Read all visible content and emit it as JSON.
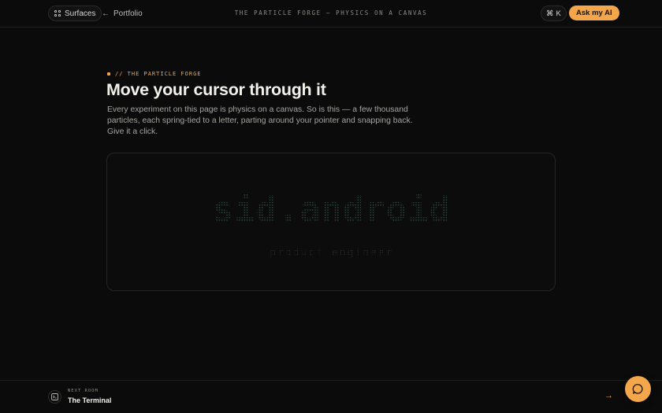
{
  "topbar": {
    "surfaces_label": "Surfaces",
    "portfolio_label": "Portfolio",
    "title": "THE PARTICLE FORGE — PHYSICS ON A CANVAS",
    "cmd_symbol": "⌘",
    "cmd_key": "K",
    "ask_label": "Ask my AI"
  },
  "hero": {
    "eyebrow": "// THE PARTICLE FORGE",
    "headline": "Move your cursor through it",
    "lede": "Every experiment on this page is physics on a canvas. So is this — a few thousand particles, each spring-tied to a letter, parting around your pointer and snapping back. Give it a click."
  },
  "canvas": {
    "primary_text": "sid.android",
    "secondary_text": "product engineer",
    "particle_color": "#2b4a3e"
  },
  "footer": {
    "next_label": "NEXT ROOM",
    "next_title": "The Terminal"
  },
  "colors": {
    "accent": "#f4a64a",
    "background": "#0b0b0b"
  },
  "icons": {
    "surfaces": "grid-icon",
    "portfolio": "arrow-left-icon",
    "next_room": "terminal-icon",
    "next_arrow": "arrow-right-icon",
    "chat": "chat-bubble-icon"
  }
}
